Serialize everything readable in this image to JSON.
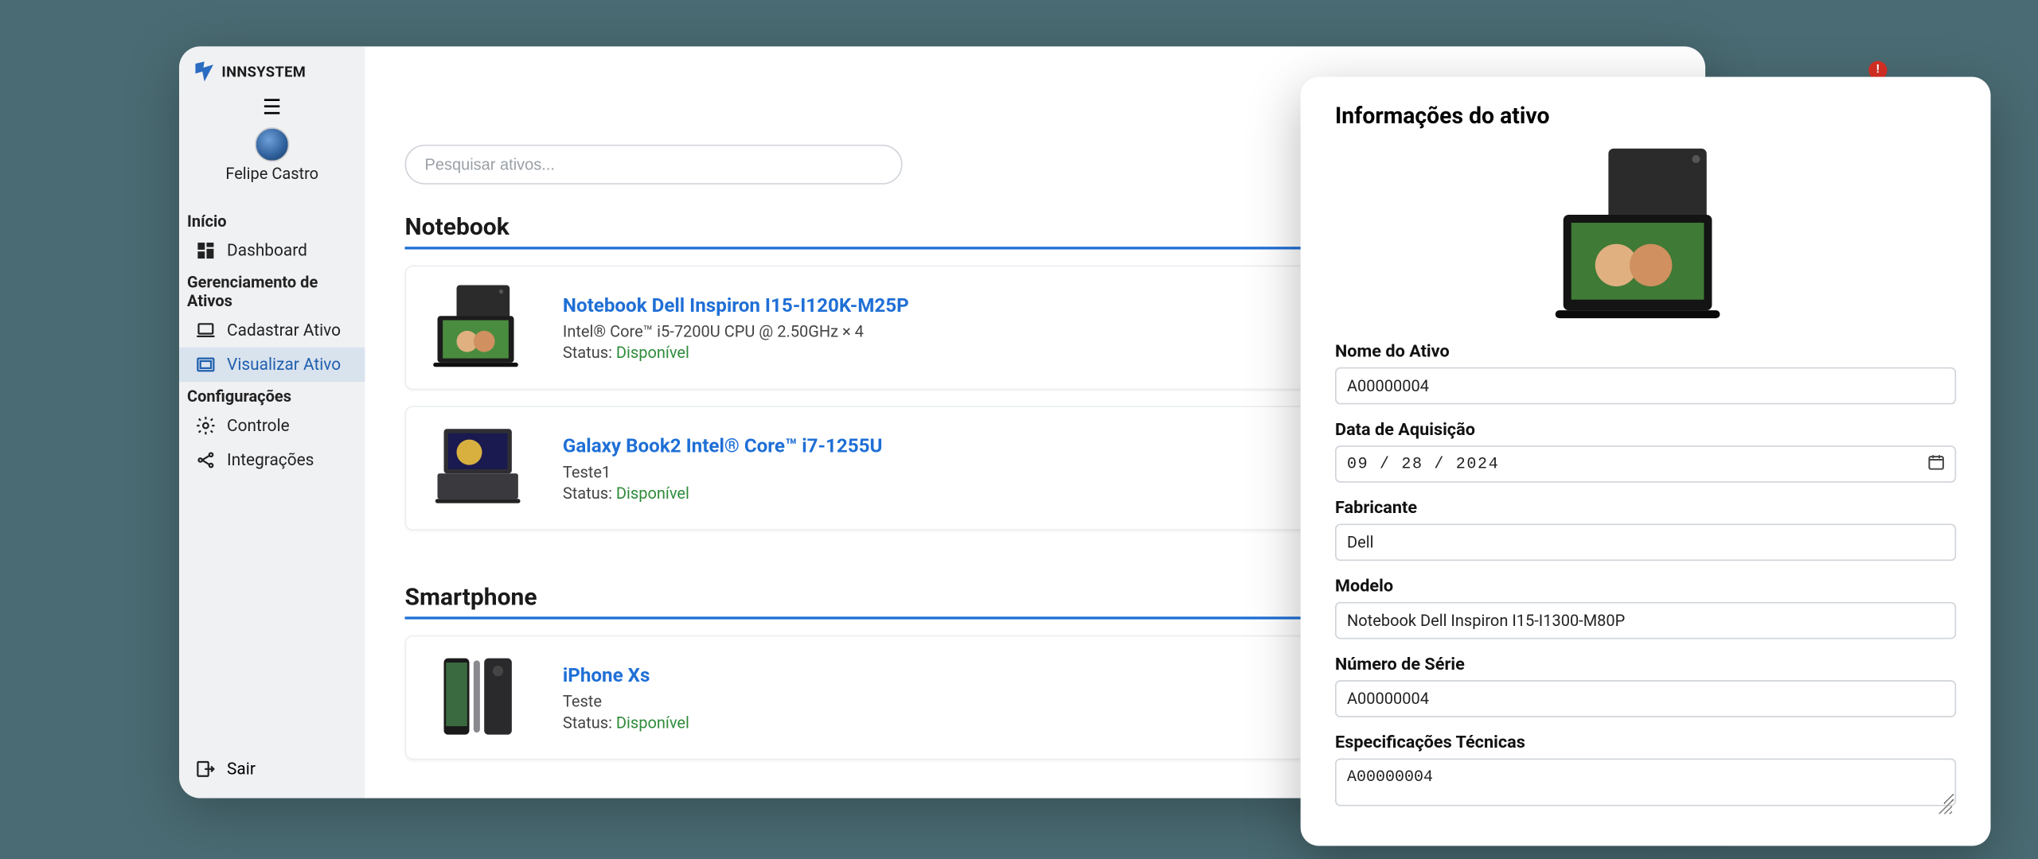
{
  "brand": {
    "name": "INNSYSTEM"
  },
  "user": {
    "name": "Felipe Castro"
  },
  "sidebar": {
    "sections": {
      "inicio": "Início",
      "gerenciamento": "Gerenciamento de Ativos",
      "config": "Configurações"
    },
    "items": {
      "dashboard": "Dashboard",
      "cadastrar": "Cadastrar Ativo",
      "visualizar": "Visualizar Ativo",
      "controle": "Controle",
      "integracoes": "Integrações"
    },
    "footer": {
      "sair": "Sair"
    }
  },
  "search": {
    "placeholder": "Pesquisar ativos..."
  },
  "categories": [
    {
      "title": "Notebook",
      "assets": [
        {
          "name": "Notebook Dell Inspiron I15-I120K-M25P",
          "spec": "Intel® Core™ i5-7200U CPU @ 2.50GHz × 4",
          "status_label": "Status:",
          "status_value": "Disponível"
        },
        {
          "name": "Galaxy Book2 Intel® Core™ i7-1255U",
          "spec": "Teste1",
          "status_label": "Status:",
          "status_value": "Disponível"
        }
      ]
    },
    {
      "title": "Smartphone",
      "assets": [
        {
          "name": "iPhone Xs",
          "spec": "Teste",
          "status_label": "Status:",
          "status_value": "Disponível"
        }
      ]
    }
  ],
  "detail": {
    "title": "Informações do ativo",
    "fields": {
      "nome_label": "Nome do Ativo",
      "nome_value": "A00000004",
      "data_label": "Data de Aquisição",
      "data_value": "09 / 28 / 2024",
      "fabricante_label": "Fabricante",
      "fabricante_value": "Dell",
      "modelo_label": "Modelo",
      "modelo_value": "Notebook Dell Inspiron I15-I1300-M80P",
      "serie_label": "Número de Série",
      "serie_value": "A00000004",
      "spec_label": "Especificações Técnicas",
      "spec_value": "A00000004"
    }
  }
}
